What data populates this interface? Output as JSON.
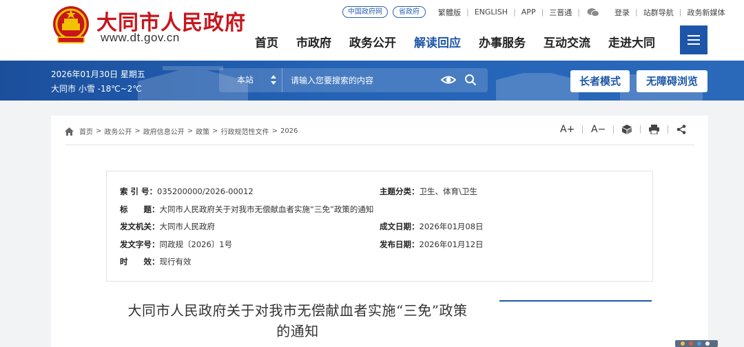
{
  "header": {
    "site_name": "大同市人民政府",
    "site_url": "www.dt.gov.cn",
    "pills": [
      "中国政府网",
      "省政府"
    ],
    "top_links": [
      "繁體版",
      "ENGLISH",
      "APP",
      "三晋通"
    ],
    "login_links": [
      "登录",
      "站群导航",
      "政务新媒体"
    ],
    "nav": [
      "首页",
      "市政府",
      "政务公开",
      "解读回应",
      "办事服务",
      "互动交流",
      "走进大同"
    ],
    "nav_active": "解读回应",
    "emblem_icon": "national-emblem-icon",
    "menu_icon": "hamburger-menu-icon"
  },
  "band": {
    "date": "2026年01月30日 星期五",
    "weather": "大同市 小雪 -18℃~2℃",
    "search_scope": "本站",
    "search_placeholder": "请输入您要搜索的内容",
    "elder_mode": "长者模式",
    "accessible": "无障碍浏览"
  },
  "breadcrumb": [
    "首页",
    "政务公开",
    "政府信息公开",
    "政策",
    "行政规范性文件",
    "2026"
  ],
  "tools": {
    "font_larger": "A+",
    "font_smaller": "A−"
  },
  "meta": {
    "index_label": "索 引 号：",
    "index_value": "035200000/2026-00012",
    "topic_label": "主题分类：",
    "topic_value": "卫生、体育\\卫生",
    "title_label": "标　　题：",
    "title_value": "大同市人民政府关于对我市无偿献血者实施“三免”政策的通知",
    "issuer_label": "发文机关：",
    "issuer_value": "大同市人民政府",
    "made_label": "成文日期：",
    "made_value": "2026年01月08日",
    "docno_label": "发文字号：",
    "docno_value": "同政规〔2026〕1号",
    "pub_label": "发布日期：",
    "pub_value": "2026年01月12日",
    "validity_label": "时　　效：",
    "validity_value": "现行有效"
  },
  "document": {
    "title_line1": "大同市人民政府关于对我市无偿献血者实施“三免”政策",
    "title_line2": "的通知"
  },
  "colors": {
    "brand_red": "#c8161d",
    "brand_blue": "#1d56a8"
  }
}
